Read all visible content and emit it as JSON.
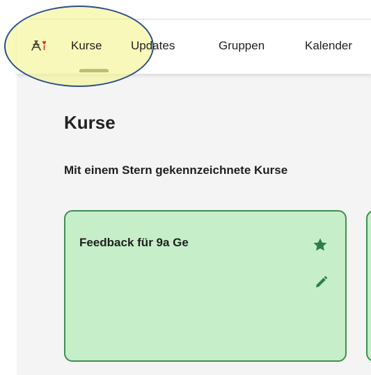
{
  "nav": {
    "logo_icon": "school-logo-icon",
    "items": [
      {
        "label": "Kurse",
        "active": true
      },
      {
        "label": "Updates",
        "active": false
      },
      {
        "label": "Gruppen",
        "active": false
      },
      {
        "label": "Kalender",
        "active": false
      }
    ]
  },
  "main": {
    "title": "Kurse",
    "subtitle": "Mit einem Stern gekennzeichnete Kurse"
  },
  "courses": [
    {
      "title": "Feedback für 9a Ge",
      "starred": true,
      "star_icon": "star-icon",
      "edit_icon": "pencil-icon"
    },
    {
      "title": ""
    }
  ],
  "colors": {
    "card_bg": "#c6eec8",
    "card_border": "#3e8e52",
    "icon_green": "#2f7d46",
    "highlight": "#f5f596",
    "highlight_border": "#2b4f8a",
    "active_indicator": "#5a5a3c",
    "content_bg": "#f4f4f4"
  }
}
